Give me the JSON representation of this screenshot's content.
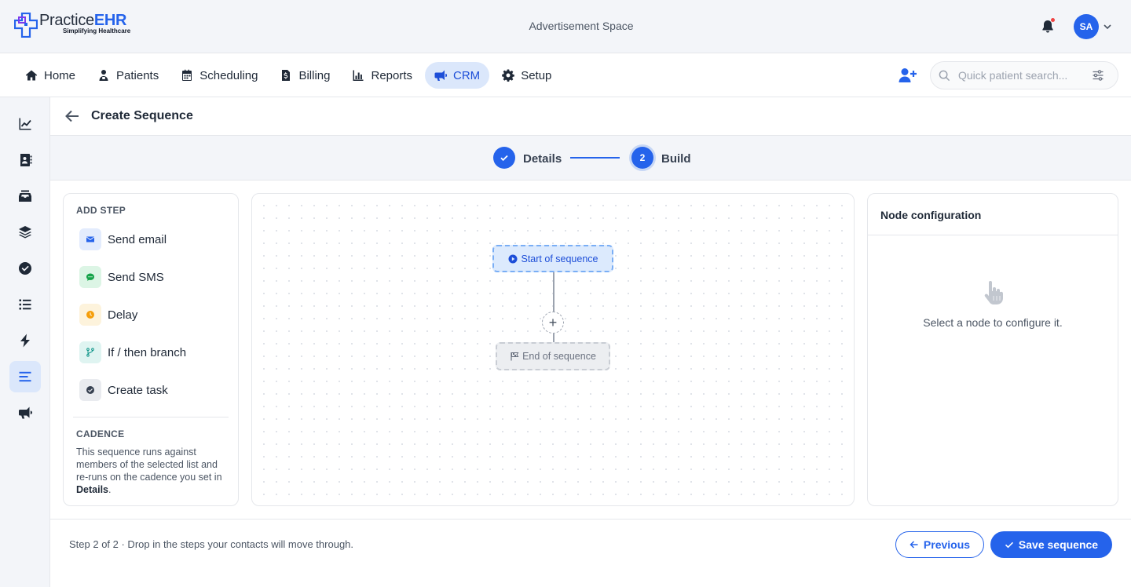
{
  "brand": {
    "name_plain": "Practice",
    "name_accent": "EHR",
    "tagline": "Simplifying Healthcare",
    "accent_color": "#2563eb"
  },
  "header": {
    "ad_space": "Advertisement Space",
    "notifications_icon": "bell-icon",
    "user_initials": "SA"
  },
  "nav": {
    "items": [
      {
        "label": "Home",
        "icon": "home-icon"
      },
      {
        "label": "Patients",
        "icon": "patients-icon"
      },
      {
        "label": "Scheduling",
        "icon": "calendar-icon"
      },
      {
        "label": "Billing",
        "icon": "billing-icon"
      },
      {
        "label": "Reports",
        "icon": "reports-icon"
      },
      {
        "label": "CRM",
        "icon": "megaphone-icon",
        "active": true
      },
      {
        "label": "Setup",
        "icon": "gear-icon"
      }
    ],
    "search_placeholder": "Quick patient search..."
  },
  "rail": {
    "items": [
      "chart-icon",
      "contacts-icon",
      "inbox-icon",
      "layers-icon",
      "check-circle-icon",
      "list-icon",
      "bolt-icon",
      "sequence-icon",
      "megaphone-icon"
    ],
    "active_index": 7
  },
  "page": {
    "title": "Create Sequence"
  },
  "stepper": {
    "steps": [
      {
        "label": "Details",
        "state": "done"
      },
      {
        "label": "Build",
        "number": "2",
        "state": "current"
      }
    ]
  },
  "add_step": {
    "heading": "ADD STEP",
    "options": [
      {
        "label": "Send email",
        "icon": "mail-icon",
        "color": "#2563eb"
      },
      {
        "label": "Send SMS",
        "icon": "chat-icon",
        "color": "#16a34a"
      },
      {
        "label": "Delay",
        "icon": "clock-icon",
        "color": "#f59e0b"
      },
      {
        "label": "If / then branch",
        "icon": "branch-icon",
        "color": "#0d9488"
      },
      {
        "label": "Create task",
        "icon": "check-circle-icon",
        "color": "#374151"
      }
    ]
  },
  "cadence": {
    "heading": "CADENCE",
    "text": "This sequence runs against members of the selected list and re-runs on the cadence you set in ",
    "link": "Details",
    "suffix": "."
  },
  "canvas": {
    "start_node": "Start of sequence",
    "end_node": "End of sequence",
    "add_symbol": "+"
  },
  "node_config": {
    "title": "Node configuration",
    "empty_message": "Select a node to configure it."
  },
  "footer": {
    "status": "Step 2 of 2 · Drop in the steps your contacts will move through.",
    "previous_label": "Previous",
    "save_label": "Save sequence"
  }
}
